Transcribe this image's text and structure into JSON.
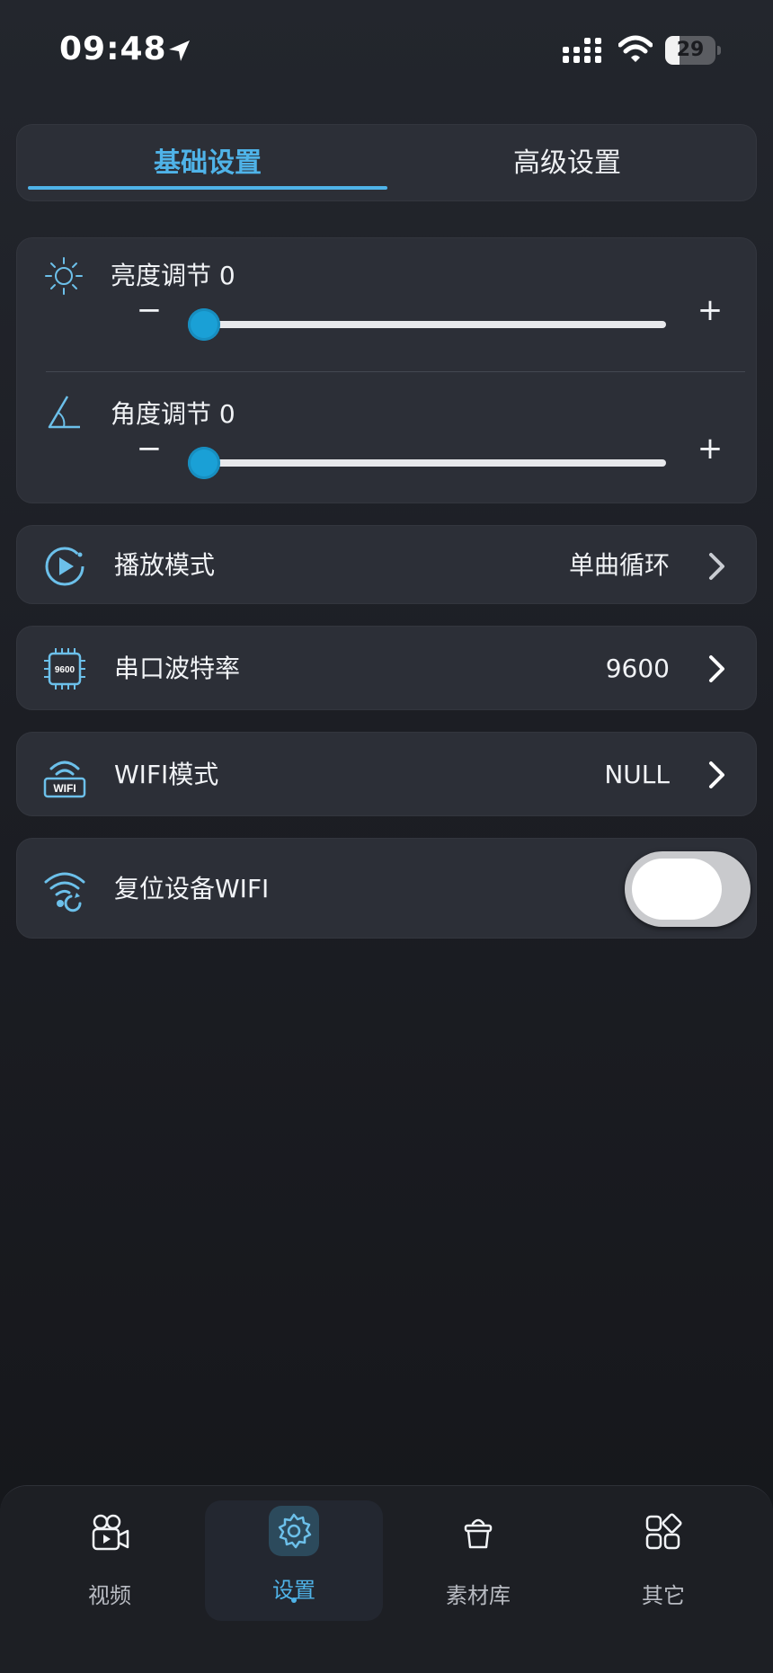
{
  "status_bar": {
    "time": "09:48",
    "battery_level": "29",
    "battery_fraction": 0.29
  },
  "tabs": [
    {
      "label": "基础设置",
      "active": true
    },
    {
      "label": "高级设置",
      "active": false
    }
  ],
  "sliders": [
    {
      "label": "亮度调节 0",
      "value": 0,
      "minus": "−",
      "plus": "+",
      "icon": "sun-icon"
    },
    {
      "label": "角度调节 0",
      "value": 0,
      "minus": "−",
      "plus": "+",
      "icon": "angle-icon"
    }
  ],
  "settings": {
    "play_mode": {
      "label": "播放模式",
      "value": "单曲循环",
      "icon": "play-circle-icon"
    },
    "baud_rate": {
      "label": "串口波特率",
      "value": "9600",
      "icon": "chip-icon",
      "icon_text": "9600"
    },
    "wifi_mode": {
      "label": "WIFI模式",
      "value": "NULL",
      "icon": "wifi-mode-icon",
      "icon_text": "WIFI"
    },
    "reset_wifi": {
      "label": "复位设备WIFI",
      "toggle_on": false,
      "icon": "wifi-reset-icon"
    }
  },
  "bottom_nav": [
    {
      "label": "视频",
      "icon": "video-icon",
      "active": false
    },
    {
      "label": "设置",
      "icon": "settings-gear-icon",
      "active": true
    },
    {
      "label": "素材库",
      "icon": "basket-icon",
      "active": false
    },
    {
      "label": "其它",
      "icon": "apps-icon",
      "active": false
    }
  ],
  "colors": {
    "accent": "#4fb3e8",
    "slider_thumb": "#1aa0d6",
    "card_bg": "#2c2f37"
  }
}
